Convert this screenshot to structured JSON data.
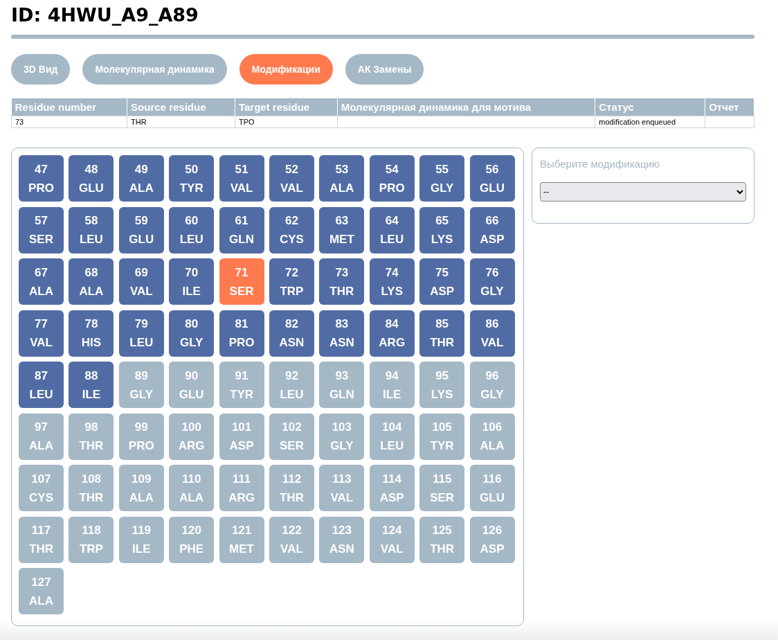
{
  "title": "ID: 4HWU_A9_A89",
  "tabs": [
    {
      "label": "3D Вид",
      "selected": false
    },
    {
      "label": "Молекулярная динамика",
      "selected": false
    },
    {
      "label": "Модификации",
      "selected": true
    },
    {
      "label": "АК Замены",
      "selected": false
    }
  ],
  "table": {
    "columns": [
      "Residue number",
      "Source residue",
      "Target residue",
      "Молекулярная динамика для мотива",
      "Статус",
      "Отчет"
    ],
    "rows": [
      [
        "73",
        "THR",
        "TPO",
        "",
        "modification enqueued",
        ""
      ]
    ]
  },
  "residues": [
    {
      "number": "47",
      "name": "PRO",
      "active": true,
      "selected": false
    },
    {
      "number": "48",
      "name": "GLU",
      "active": true,
      "selected": false
    },
    {
      "number": "49",
      "name": "ALA",
      "active": true,
      "selected": false
    },
    {
      "number": "50",
      "name": "TYR",
      "active": true,
      "selected": false
    },
    {
      "number": "51",
      "name": "VAL",
      "active": true,
      "selected": false
    },
    {
      "number": "52",
      "name": "VAL",
      "active": true,
      "selected": false
    },
    {
      "number": "53",
      "name": "ALA",
      "active": true,
      "selected": false
    },
    {
      "number": "54",
      "name": "PRO",
      "active": true,
      "selected": false
    },
    {
      "number": "55",
      "name": "GLY",
      "active": true,
      "selected": false
    },
    {
      "number": "56",
      "name": "GLU",
      "active": true,
      "selected": false
    },
    {
      "number": "57",
      "name": "SER",
      "active": true,
      "selected": false
    },
    {
      "number": "58",
      "name": "LEU",
      "active": true,
      "selected": false
    },
    {
      "number": "59",
      "name": "GLU",
      "active": true,
      "selected": false
    },
    {
      "number": "60",
      "name": "LEU",
      "active": true,
      "selected": false
    },
    {
      "number": "61",
      "name": "GLN",
      "active": true,
      "selected": false
    },
    {
      "number": "62",
      "name": "CYS",
      "active": true,
      "selected": false
    },
    {
      "number": "63",
      "name": "MET",
      "active": true,
      "selected": false
    },
    {
      "number": "64",
      "name": "LEU",
      "active": true,
      "selected": false
    },
    {
      "number": "65",
      "name": "LYS",
      "active": true,
      "selected": false
    },
    {
      "number": "66",
      "name": "ASP",
      "active": true,
      "selected": false
    },
    {
      "number": "67",
      "name": "ALA",
      "active": true,
      "selected": false
    },
    {
      "number": "68",
      "name": "ALA",
      "active": true,
      "selected": false
    },
    {
      "number": "69",
      "name": "VAL",
      "active": true,
      "selected": false
    },
    {
      "number": "70",
      "name": "ILE",
      "active": true,
      "selected": false
    },
    {
      "number": "71",
      "name": "SER",
      "active": true,
      "selected": true
    },
    {
      "number": "72",
      "name": "TRP",
      "active": true,
      "selected": false
    },
    {
      "number": "73",
      "name": "THR",
      "active": true,
      "selected": false
    },
    {
      "number": "74",
      "name": "LYS",
      "active": true,
      "selected": false
    },
    {
      "number": "75",
      "name": "ASP",
      "active": true,
      "selected": false
    },
    {
      "number": "76",
      "name": "GLY",
      "active": true,
      "selected": false
    },
    {
      "number": "77",
      "name": "VAL",
      "active": true,
      "selected": false
    },
    {
      "number": "78",
      "name": "HIS",
      "active": true,
      "selected": false
    },
    {
      "number": "79",
      "name": "LEU",
      "active": true,
      "selected": false
    },
    {
      "number": "80",
      "name": "GLY",
      "active": true,
      "selected": false
    },
    {
      "number": "81",
      "name": "PRO",
      "active": true,
      "selected": false
    },
    {
      "number": "82",
      "name": "ASN",
      "active": true,
      "selected": false
    },
    {
      "number": "83",
      "name": "ASN",
      "active": true,
      "selected": false
    },
    {
      "number": "84",
      "name": "ARG",
      "active": true,
      "selected": false
    },
    {
      "number": "85",
      "name": "THR",
      "active": true,
      "selected": false
    },
    {
      "number": "86",
      "name": "VAL",
      "active": true,
      "selected": false
    },
    {
      "number": "87",
      "name": "LEU",
      "active": true,
      "selected": false
    },
    {
      "number": "88",
      "name": "ILE",
      "active": true,
      "selected": false
    },
    {
      "number": "89",
      "name": "GLY",
      "active": false,
      "selected": false
    },
    {
      "number": "90",
      "name": "GLU",
      "active": false,
      "selected": false
    },
    {
      "number": "91",
      "name": "TYR",
      "active": false,
      "selected": false
    },
    {
      "number": "92",
      "name": "LEU",
      "active": false,
      "selected": false
    },
    {
      "number": "93",
      "name": "GLN",
      "active": false,
      "selected": false
    },
    {
      "number": "94",
      "name": "ILE",
      "active": false,
      "selected": false
    },
    {
      "number": "95",
      "name": "LYS",
      "active": false,
      "selected": false
    },
    {
      "number": "96",
      "name": "GLY",
      "active": false,
      "selected": false
    },
    {
      "number": "97",
      "name": "ALA",
      "active": false,
      "selected": false
    },
    {
      "number": "98",
      "name": "THR",
      "active": false,
      "selected": false
    },
    {
      "number": "99",
      "name": "PRO",
      "active": false,
      "selected": false
    },
    {
      "number": "100",
      "name": "ARG",
      "active": false,
      "selected": false
    },
    {
      "number": "101",
      "name": "ASP",
      "active": false,
      "selected": false
    },
    {
      "number": "102",
      "name": "SER",
      "active": false,
      "selected": false
    },
    {
      "number": "103",
      "name": "GLY",
      "active": false,
      "selected": false
    },
    {
      "number": "104",
      "name": "LEU",
      "active": false,
      "selected": false
    },
    {
      "number": "105",
      "name": "TYR",
      "active": false,
      "selected": false
    },
    {
      "number": "106",
      "name": "ALA",
      "active": false,
      "selected": false
    },
    {
      "number": "107",
      "name": "CYS",
      "active": false,
      "selected": false
    },
    {
      "number": "108",
      "name": "THR",
      "active": false,
      "selected": false
    },
    {
      "number": "109",
      "name": "ALA",
      "active": false,
      "selected": false
    },
    {
      "number": "110",
      "name": "ALA",
      "active": false,
      "selected": false
    },
    {
      "number": "111",
      "name": "ARG",
      "active": false,
      "selected": false
    },
    {
      "number": "112",
      "name": "THR",
      "active": false,
      "selected": false
    },
    {
      "number": "113",
      "name": "VAL",
      "active": false,
      "selected": false
    },
    {
      "number": "114",
      "name": "ASP",
      "active": false,
      "selected": false
    },
    {
      "number": "115",
      "name": "SER",
      "active": false,
      "selected": false
    },
    {
      "number": "116",
      "name": "GLU",
      "active": false,
      "selected": false
    },
    {
      "number": "117",
      "name": "THR",
      "active": false,
      "selected": false
    },
    {
      "number": "118",
      "name": "TRP",
      "active": false,
      "selected": false
    },
    {
      "number": "119",
      "name": "ILE",
      "active": false,
      "selected": false
    },
    {
      "number": "120",
      "name": "PHE",
      "active": false,
      "selected": false
    },
    {
      "number": "121",
      "name": "MET",
      "active": false,
      "selected": false
    },
    {
      "number": "122",
      "name": "VAL",
      "active": false,
      "selected": false
    },
    {
      "number": "123",
      "name": "ASN",
      "active": false,
      "selected": false
    },
    {
      "number": "124",
      "name": "VAL",
      "active": false,
      "selected": false
    },
    {
      "number": "125",
      "name": "THR",
      "active": false,
      "selected": false
    },
    {
      "number": "126",
      "name": "ASP",
      "active": false,
      "selected": false
    },
    {
      "number": "127",
      "name": "ALA",
      "active": false,
      "selected": false
    }
  ],
  "modification_panel": {
    "label": "Выберите модификацию",
    "select_value": "--"
  }
}
